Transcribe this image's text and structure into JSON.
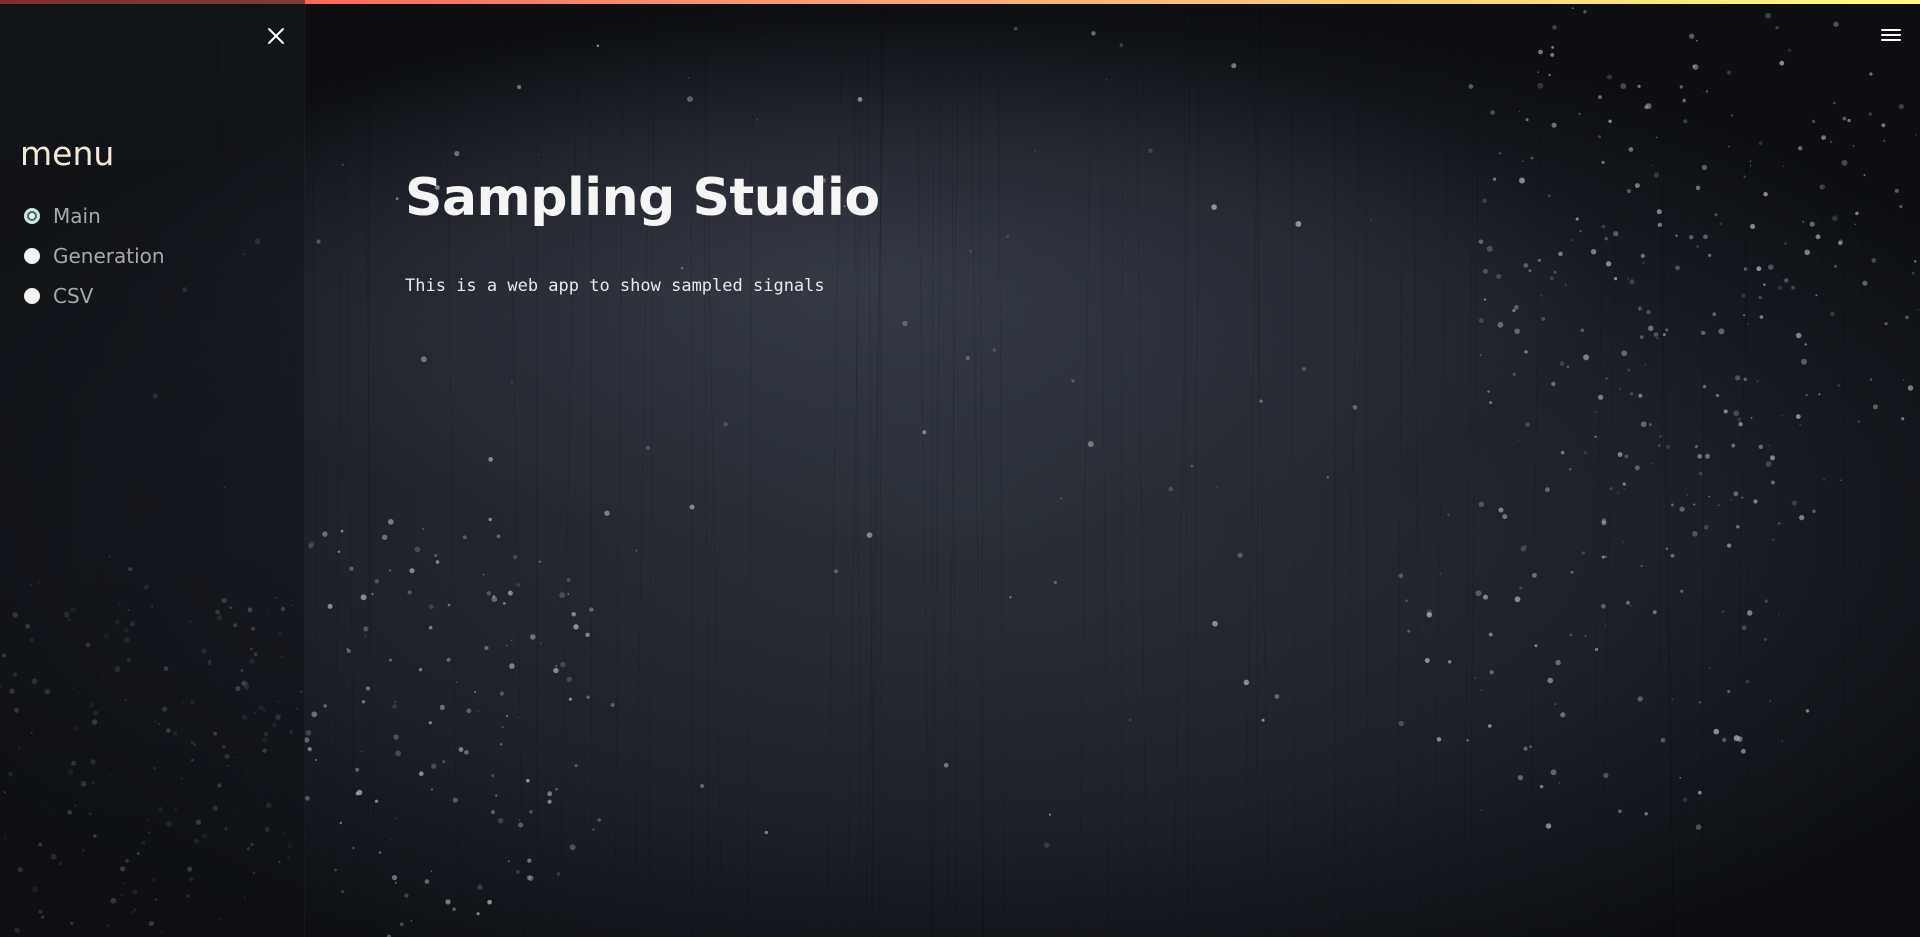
{
  "colors": {
    "top_bar_start": "#ff4b4b",
    "top_bar_mid": "#f7a27a",
    "top_bar_end": "#fffd80",
    "background": "#1b1f27",
    "sidebar_title": "#f1e9d6",
    "radio_label": "#a7a8ab",
    "radio_selected": "#3b6a6a",
    "text": "#f5f5f5"
  },
  "icons": {
    "close": "close-icon",
    "menu": "hamburger-menu-icon"
  },
  "sidebar": {
    "title": "menu",
    "options": [
      {
        "label": "Main",
        "selected": true
      },
      {
        "label": "Generation",
        "selected": false
      },
      {
        "label": "CSV",
        "selected": false
      }
    ]
  },
  "main": {
    "title": "Sampling Studio",
    "description": "This is a web app to show sampled signals"
  }
}
